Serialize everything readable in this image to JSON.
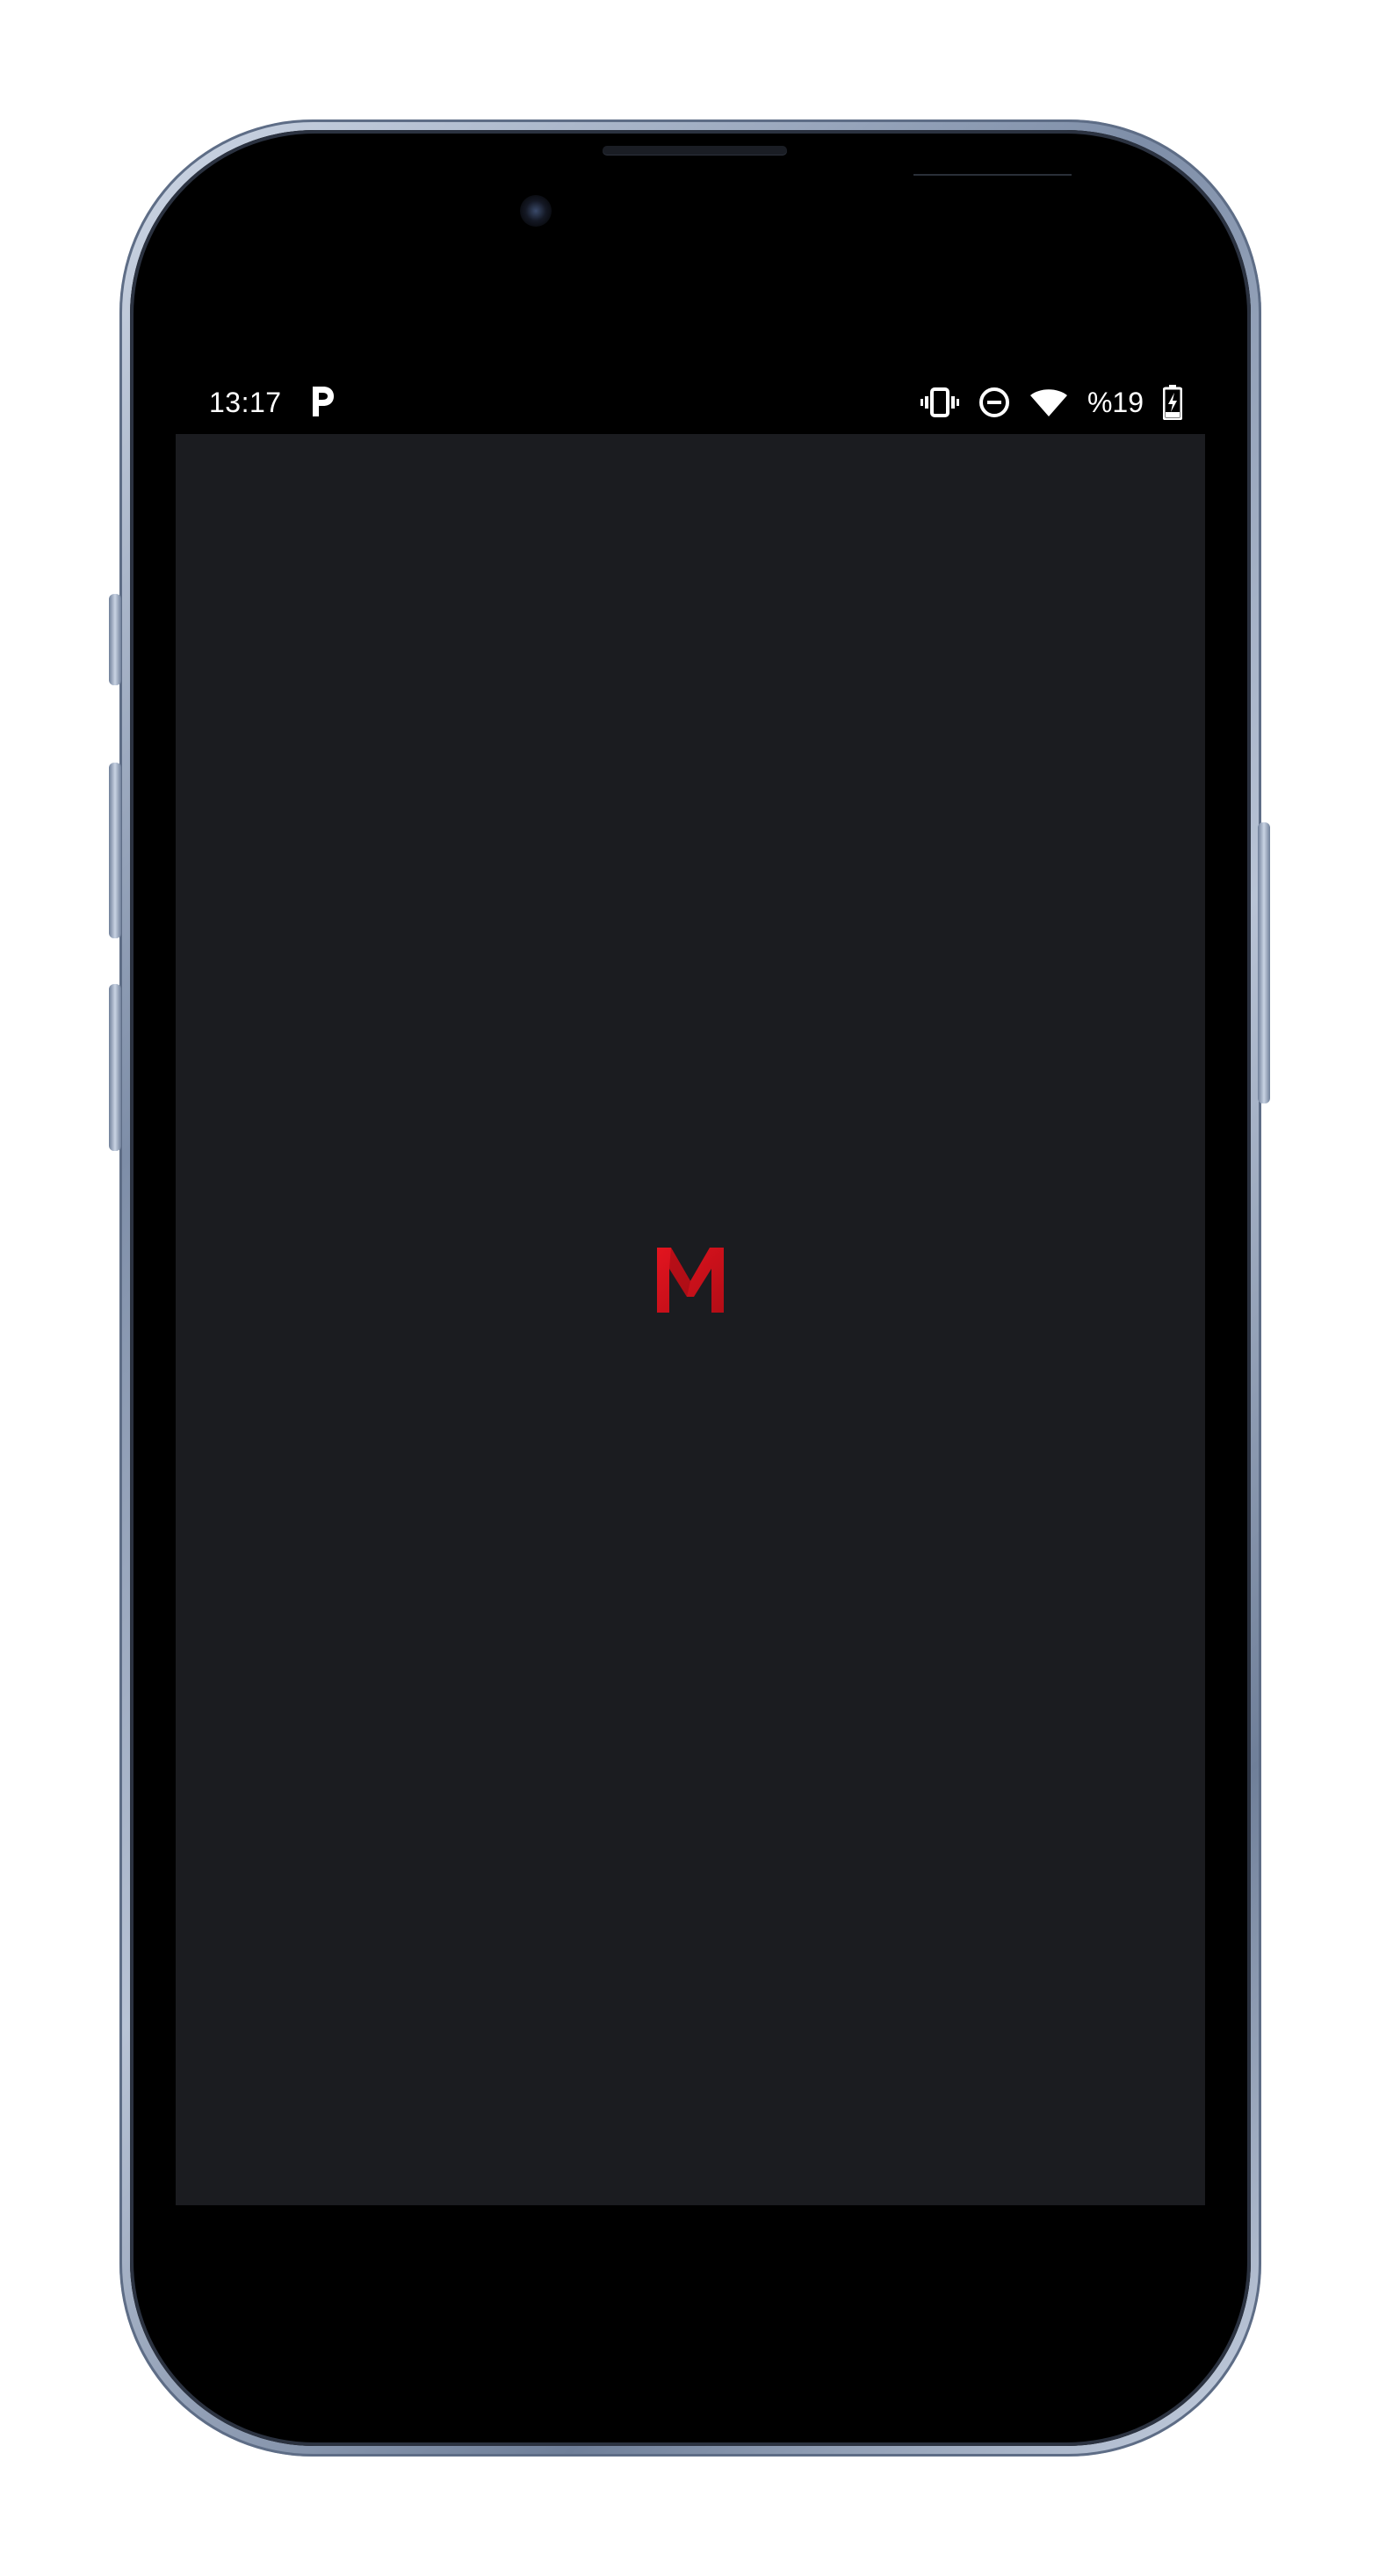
{
  "status_bar": {
    "time": "13:17",
    "app_notification_icon": "p-icon",
    "icons": [
      "vibrate-icon",
      "do-not-disturb-icon",
      "wifi-icon"
    ],
    "battery_text": "%19",
    "battery_icon": "battery-charging-icon"
  },
  "splash": {
    "logo_letter": "M",
    "logo_color": "#d0121c",
    "background_color": "#1b1c20"
  }
}
